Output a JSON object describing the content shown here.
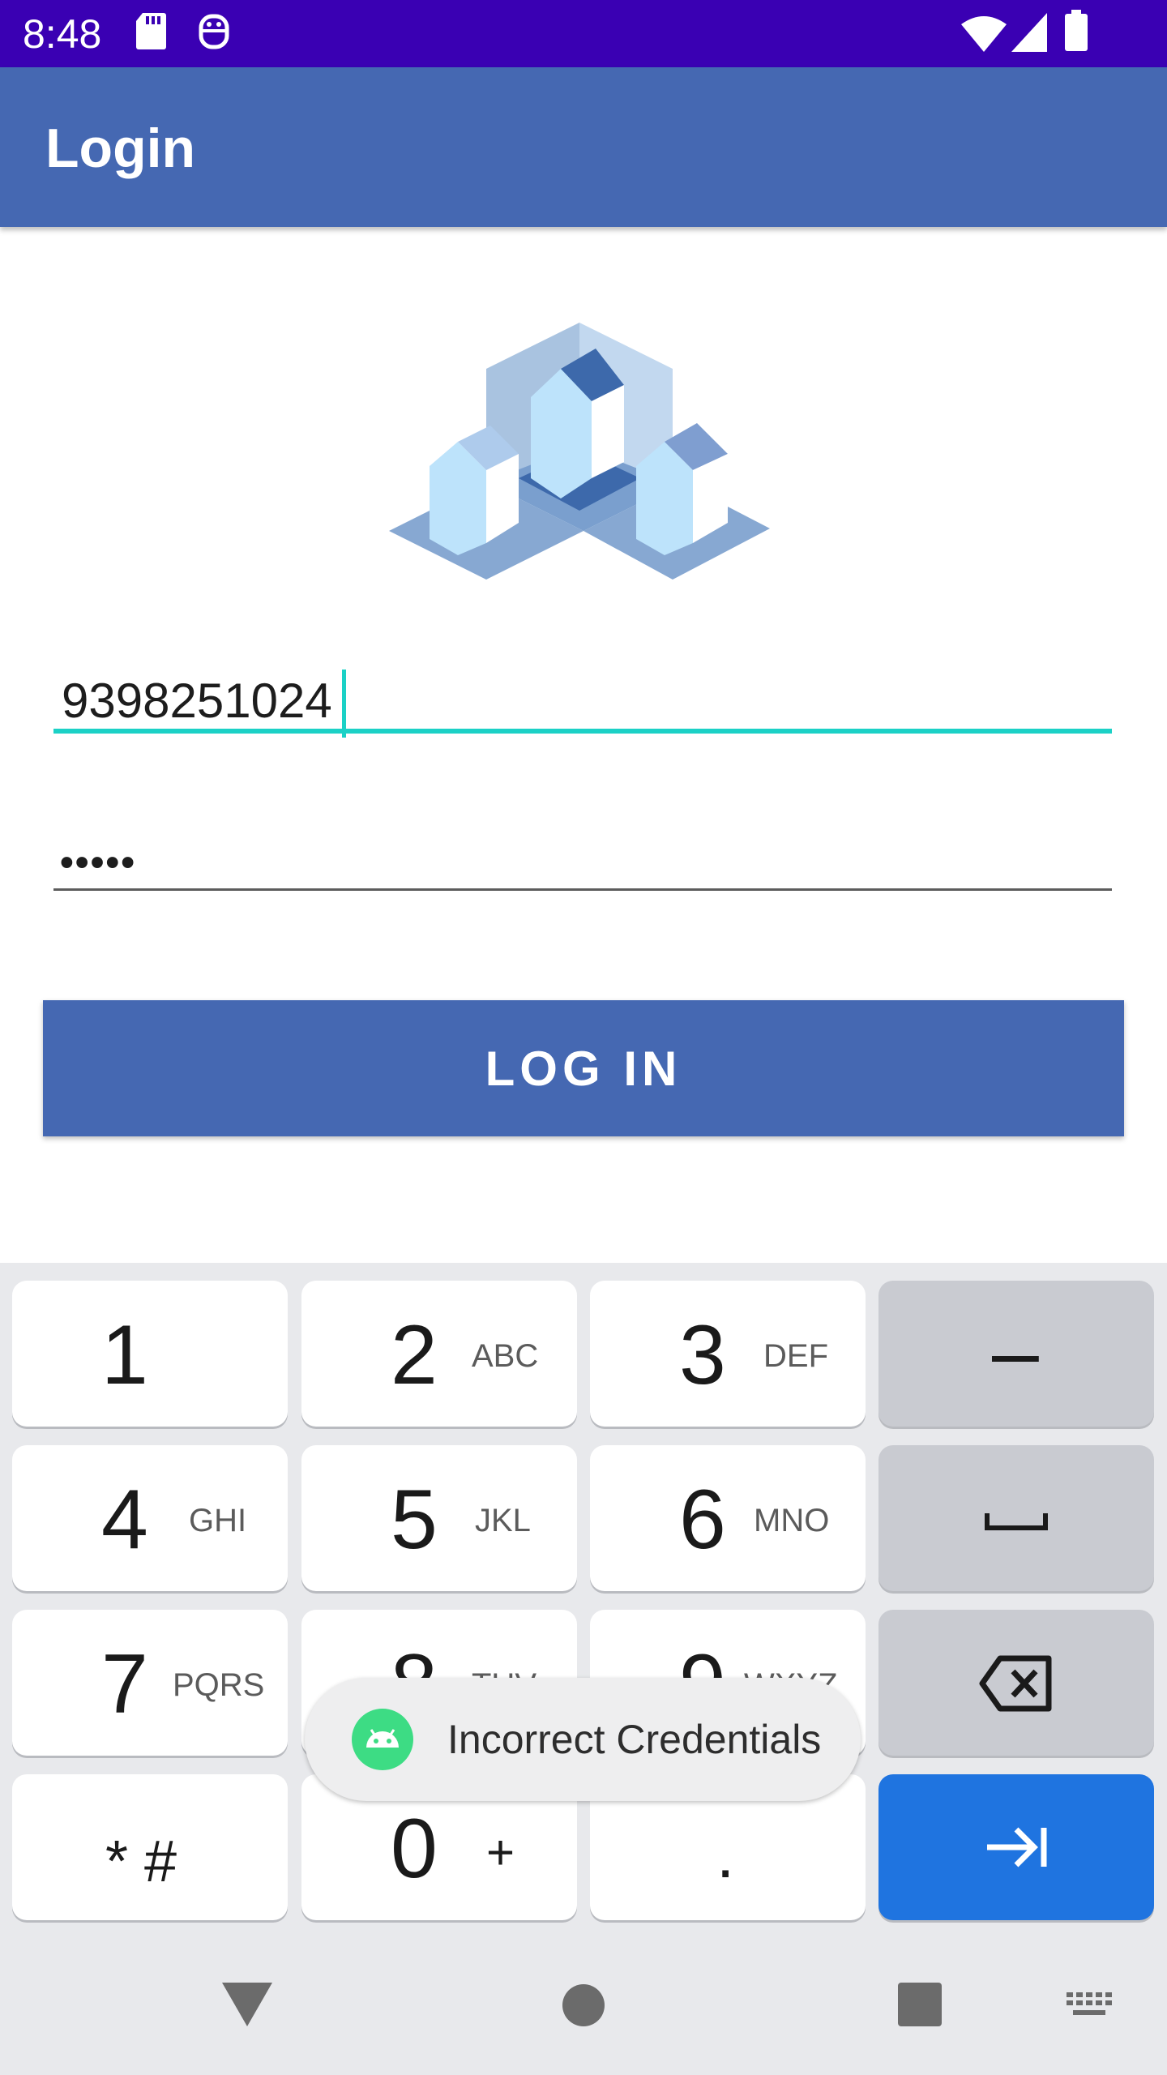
{
  "status_bar": {
    "time": "8:48",
    "icons": [
      "sd-card-icon",
      "android-debug-icon",
      "wifi-icon",
      "signal-icon",
      "battery-icon"
    ]
  },
  "app_bar": {
    "title": "Login"
  },
  "form": {
    "username_value": "9398251024",
    "password_value": "•••••",
    "login_label": "LOG IN"
  },
  "keyboard": {
    "keys": [
      {
        "num": "1",
        "letters": ""
      },
      {
        "num": "2",
        "letters": "ABC"
      },
      {
        "num": "3",
        "letters": "DEF"
      },
      {
        "num": "–",
        "letters": ""
      },
      {
        "num": "4",
        "letters": "GHI"
      },
      {
        "num": "5",
        "letters": "JKL"
      },
      {
        "num": "6",
        "letters": "MNO"
      },
      {
        "num": "␣",
        "letters": ""
      },
      {
        "num": "7",
        "letters": "PQRS"
      },
      {
        "num": "8",
        "letters": "TUV"
      },
      {
        "num": "9",
        "letters": "WXYZ"
      },
      {
        "num": "⌫",
        "letters": ""
      },
      {
        "num": "* #",
        "letters": ""
      },
      {
        "num": "0",
        "letters": "+"
      },
      {
        "num": ".",
        "letters": ""
      },
      {
        "num": "⇥",
        "letters": ""
      }
    ]
  },
  "toast": {
    "message": "Incorrect Credentials"
  },
  "colors": {
    "status_bar": "#3a00b3",
    "app_bar": "#4568b2",
    "accent": "#1bd1c6",
    "button": "#4568b2",
    "keyboard_action": "#1f74e0"
  }
}
